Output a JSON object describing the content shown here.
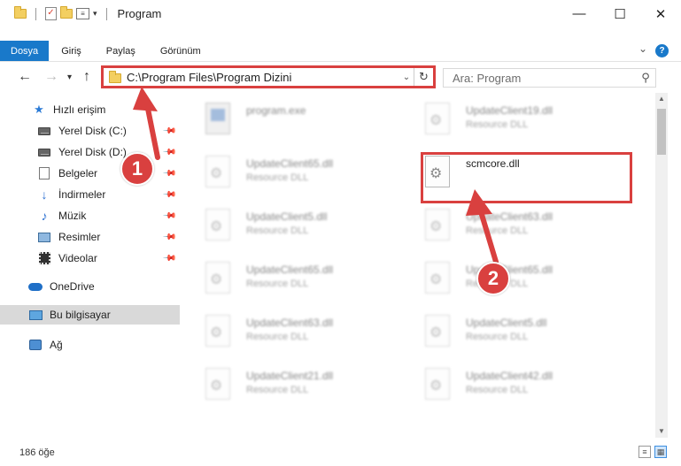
{
  "window": {
    "title": "Program",
    "quick_access_icons": [
      "folder-icon",
      "checkmark-icon",
      "new-folder-icon",
      "properties-icon",
      "dropdown-icon"
    ],
    "controls": [
      "minimize",
      "maximize",
      "close"
    ]
  },
  "ribbon": {
    "tabs": [
      "Dosya",
      "Giriş",
      "Paylaş",
      "Görünüm"
    ],
    "active_tab_color": "#1979CA",
    "help_label": "?"
  },
  "address": {
    "path": "C:\\Program Files\\Program Dizini",
    "search_placeholder": "Ara: Program",
    "highlight_color": "#D9403F"
  },
  "sidebar": {
    "items": [
      {
        "label": "Hızlı erişim",
        "icon": "star-icon"
      },
      {
        "label": "Yerel Disk (C:)",
        "icon": "drive-icon",
        "pinned": true
      },
      {
        "label": "Yerel Disk (D:)",
        "icon": "drive-icon",
        "pinned": true
      },
      {
        "label": "Belgeler",
        "icon": "document-icon",
        "pinned": true
      },
      {
        "label": "İndirmeler",
        "icon": "download-icon",
        "pinned": true
      },
      {
        "label": "Müzik",
        "icon": "music-icon",
        "pinned": true
      },
      {
        "label": "Resimler",
        "icon": "pictures-icon",
        "pinned": true
      },
      {
        "label": "Videolar",
        "icon": "video-icon",
        "pinned": true
      },
      {
        "label": "OneDrive",
        "icon": "cloud-icon"
      },
      {
        "label": "Bu bilgisayar",
        "icon": "computer-icon",
        "selected": true
      },
      {
        "label": "Ağ",
        "icon": "network-icon"
      }
    ]
  },
  "files": [
    {
      "name": "program.exe",
      "type": "",
      "blurred": true
    },
    {
      "name": "UpdateClient19.dll",
      "type": "Resource DLL",
      "blurred": true
    },
    {
      "name": "UpdateClient65.dll",
      "type": "Resource DLL",
      "blurred": true
    },
    {
      "name": "scmcore.dll",
      "type": "",
      "blurred": false
    },
    {
      "name": "UpdateClient5.dll",
      "type": "Resource DLL",
      "blurred": true
    },
    {
      "name": "UpdateClient63.dll",
      "type": "Resource DLL",
      "blurred": true
    },
    {
      "name": "UpdateClient65.dll",
      "type": "Resource DLL",
      "blurred": true
    },
    {
      "name": "UpdateClient65.dll",
      "type": "Resource DLL",
      "blurred": true
    },
    {
      "name": "UpdateClient63.dll",
      "type": "Resource DLL",
      "blurred": true
    },
    {
      "name": "UpdateClient5.dll",
      "type": "Resource DLL",
      "blurred": true
    },
    {
      "name": "UpdateClient21.dll",
      "type": "Resource DLL",
      "blurred": true
    },
    {
      "name": "UpdateClient42.dll",
      "type": "Resource DLL",
      "blurred": true
    }
  ],
  "status": {
    "item_count": "186 öğe"
  },
  "annotations": {
    "step1": "1",
    "step2": "2",
    "color": "#D9403F"
  }
}
